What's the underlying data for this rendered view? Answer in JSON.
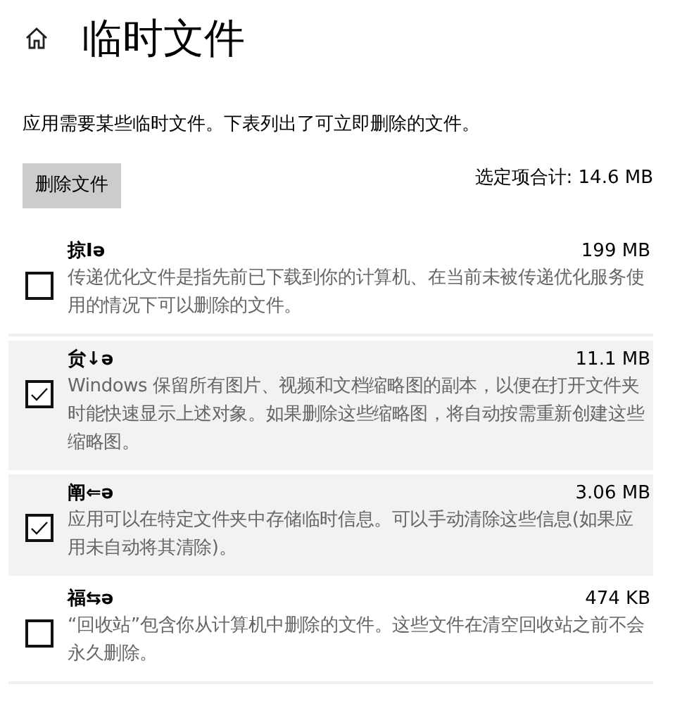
{
  "title": "临时文件",
  "intro": "应用需要某些临时文件。下表列出了可立即删除的文件。",
  "delete_button": "删除文件",
  "total": "选定项合计: 14.6 MB",
  "items": [
    {
      "name": "掠Iə",
      "size": "199 MB",
      "description": "传递优化文件是指先前已下载到你的计算机、在当前未被传递优化服务使用的情况下可以删除的文件。",
      "checked": false
    },
    {
      "name": "贠↓ə",
      "size": "11.1 MB",
      "description": "Windows 保留所有图片、视频和文档缩略图的副本，以便在打开文件夹时能快速显示上述对象。如果删除这些缩略图，将自动按需重新创建这些缩略图。",
      "checked": true
    },
    {
      "name": "阐⇐ə",
      "size": "3.06 MB",
      "description": "应用可以在特定文件夹中存储临时信息。可以手动清除这些信息(如果应用未自动将其清除)。",
      "checked": true
    },
    {
      "name": "福⇆ə",
      "size": "474 KB",
      "description": "“回收站”包含你从计算机中删除的文件。这些文件在清空回收站之前不会永久删除。",
      "checked": false
    }
  ]
}
